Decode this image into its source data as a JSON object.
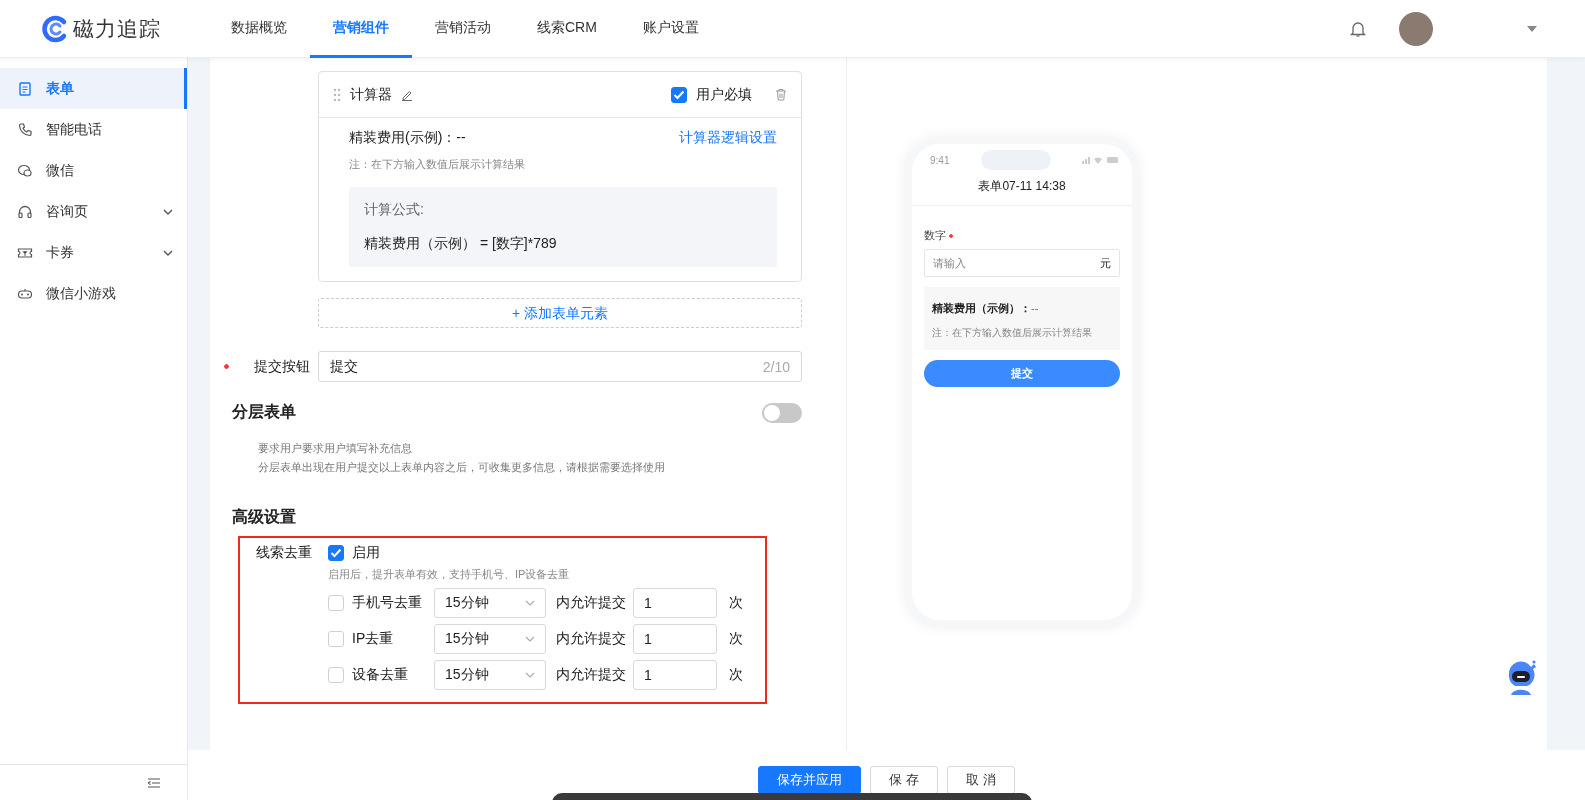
{
  "header": {
    "logo": "磁力追踪",
    "nav": [
      {
        "label": "数据概览",
        "selected": false
      },
      {
        "label": "营销组件",
        "selected": true
      },
      {
        "label": "营销活动",
        "selected": false
      },
      {
        "label": "线索CRM",
        "selected": false
      },
      {
        "label": "账户设置",
        "selected": false
      }
    ]
  },
  "sidebar": {
    "items": [
      {
        "label": "表单",
        "kind": "form",
        "selected": true,
        "expandable": false
      },
      {
        "label": "智能电话",
        "kind": "phone",
        "selected": false,
        "expandable": false
      },
      {
        "label": "微信",
        "kind": "chat",
        "selected": false,
        "expandable": false
      },
      {
        "label": "咨询页",
        "kind": "headset",
        "selected": false,
        "expandable": true
      },
      {
        "label": "卡券",
        "kind": "ticket",
        "selected": false,
        "expandable": true
      },
      {
        "label": "微信小游戏",
        "kind": "gamepad",
        "selected": false,
        "expandable": false
      }
    ]
  },
  "calculator": {
    "title": "计算器",
    "required": {
      "label": "用户必填",
      "checked": true
    },
    "result_label": "精装费用(示例)：--",
    "link": "计算器逻辑设置",
    "note": "注：在下方输入数值后展示计算结果",
    "formula_title": "计算公式:",
    "formula": "精装费用（示例） = [数字]*789"
  },
  "add_element": "+ 添加表单元素",
  "submit_field": {
    "label": "提交按钮",
    "required": true,
    "value": "提交",
    "count": "2/10"
  },
  "layered_form": {
    "title": "分层表单",
    "on": false,
    "description": [
      "要求用户要求用户填写补充信息",
      "分层表单出现在用户提交以上表单内容之后，可收集更多信息，请根据需要选择使用"
    ]
  },
  "advanced": {
    "title": "高级设置",
    "dedupe": {
      "label": "线索去重",
      "enable": {
        "label": "启用",
        "checked": true
      },
      "hint": "启用后，提升表单有效，支持手机号、IP设备去重",
      "rules": [
        {
          "label": "手机号去重",
          "checked": false,
          "period": "15分钟",
          "middle": "内允许提交",
          "value": "1",
          "unit": "次"
        },
        {
          "label": "IP去重",
          "checked": false,
          "period": "15分钟",
          "middle": "内允许提交",
          "value": "1",
          "unit": "次"
        },
        {
          "label": "设备去重",
          "checked": false,
          "period": "15分钟",
          "middle": "内允许提交",
          "value": "1",
          "unit": "次"
        }
      ]
    }
  },
  "preview": {
    "status_time": "9:41",
    "title": "表单07-11 14:38",
    "field_label": "数字",
    "required": true,
    "placeholder": "请输入",
    "unit": "元",
    "result_label": "精装费用（示例）：",
    "result_value": "--",
    "note": "注：在下方输入数值后展示计算结果",
    "submit": "提交"
  },
  "footer": {
    "buttons": [
      {
        "label": "保存并应用",
        "kind": "primary"
      },
      {
        "label": "保 存",
        "kind": "default"
      },
      {
        "label": "取 消",
        "kind": "default"
      }
    ]
  }
}
